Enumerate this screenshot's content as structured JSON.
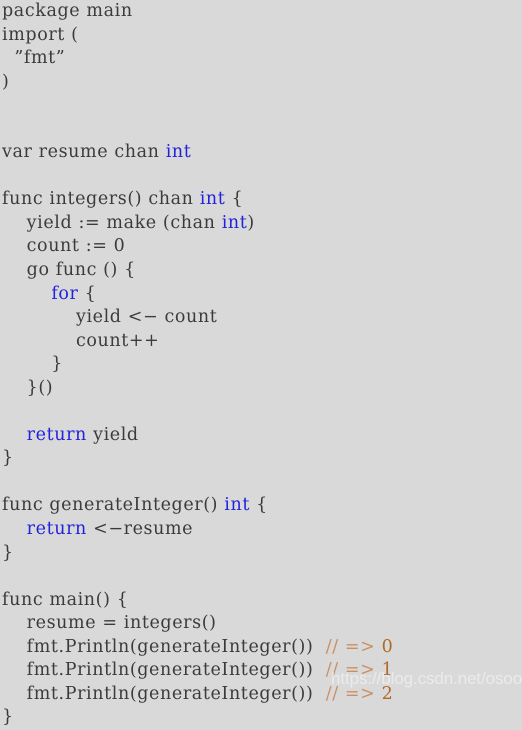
{
  "document": {
    "kind": "code-listing",
    "language": "Go",
    "background_color": "#d9d9d9",
    "default_text_color": "#3b3b3b",
    "keyword_color": "#2222dd",
    "comment_color": "#c98f63",
    "comment_number_color": "#b06a28",
    "watermark_color": "#ededed"
  },
  "watermark": {
    "text": "https://blog.csdn.net/osoon"
  },
  "code": {
    "lines": [
      {
        "indent": 0,
        "tokens": [
          {
            "t": "package main",
            "c": "plain"
          }
        ]
      },
      {
        "indent": 0,
        "tokens": [
          {
            "t": "import (",
            "c": "plain"
          }
        ]
      },
      {
        "indent": 0,
        "tokens": [
          {
            "t": "  ”fmt”",
            "c": "str"
          }
        ]
      },
      {
        "indent": 0,
        "tokens": [
          {
            "t": ")",
            "c": "plain"
          }
        ]
      },
      {
        "indent": 0,
        "tokens": []
      },
      {
        "indent": 0,
        "tokens": []
      },
      {
        "indent": 0,
        "tokens": [
          {
            "t": "var resume chan ",
            "c": "plain"
          },
          {
            "t": "int",
            "c": "kw"
          }
        ]
      },
      {
        "indent": 0,
        "tokens": []
      },
      {
        "indent": 0,
        "tokens": [
          {
            "t": "func integers() chan ",
            "c": "plain"
          },
          {
            "t": "int",
            "c": "kw"
          },
          {
            "t": " {",
            "c": "plain"
          }
        ]
      },
      {
        "indent": 0,
        "tokens": [
          {
            "t": "    yield := make (chan ",
            "c": "plain"
          },
          {
            "t": "int",
            "c": "kw"
          },
          {
            "t": ")",
            "c": "plain"
          }
        ]
      },
      {
        "indent": 0,
        "tokens": [
          {
            "t": "    count := 0",
            "c": "plain"
          }
        ]
      },
      {
        "indent": 0,
        "tokens": [
          {
            "t": "    go func () {",
            "c": "plain"
          }
        ]
      },
      {
        "indent": 0,
        "tokens": [
          {
            "t": "        ",
            "c": "plain"
          },
          {
            "t": "for",
            "c": "kw"
          },
          {
            "t": " {",
            "c": "plain"
          }
        ]
      },
      {
        "indent": 0,
        "tokens": [
          {
            "t": "            yield <− count",
            "c": "plain"
          }
        ]
      },
      {
        "indent": 0,
        "tokens": [
          {
            "t": "            count++",
            "c": "plain"
          }
        ]
      },
      {
        "indent": 0,
        "tokens": [
          {
            "t": "        }",
            "c": "plain"
          }
        ]
      },
      {
        "indent": 0,
        "tokens": [
          {
            "t": "    }()",
            "c": "plain"
          }
        ]
      },
      {
        "indent": 0,
        "tokens": []
      },
      {
        "indent": 0,
        "tokens": [
          {
            "t": "    ",
            "c": "plain"
          },
          {
            "t": "return",
            "c": "kw"
          },
          {
            "t": " yield",
            "c": "plain"
          }
        ]
      },
      {
        "indent": 0,
        "tokens": [
          {
            "t": "}",
            "c": "plain"
          }
        ]
      },
      {
        "indent": 0,
        "tokens": []
      },
      {
        "indent": 0,
        "tokens": [
          {
            "t": "func generateInteger() ",
            "c": "plain"
          },
          {
            "t": "int",
            "c": "kw"
          },
          {
            "t": " {",
            "c": "plain"
          }
        ]
      },
      {
        "indent": 0,
        "tokens": [
          {
            "t": "    ",
            "c": "plain"
          },
          {
            "t": "return",
            "c": "kw"
          },
          {
            "t": " <−resume",
            "c": "plain"
          }
        ]
      },
      {
        "indent": 0,
        "tokens": [
          {
            "t": "}",
            "c": "plain"
          }
        ]
      },
      {
        "indent": 0,
        "tokens": []
      },
      {
        "indent": 0,
        "tokens": [
          {
            "t": "func main() {",
            "c": "plain"
          }
        ]
      },
      {
        "indent": 0,
        "tokens": [
          {
            "t": "    resume = integers()",
            "c": "plain"
          }
        ]
      },
      {
        "indent": 0,
        "tokens": [
          {
            "t": "    fmt.Println(generateInteger())  ",
            "c": "plain"
          },
          {
            "t": "// => ",
            "c": "cmt"
          },
          {
            "t": "0",
            "c": "cmtnum"
          }
        ]
      },
      {
        "indent": 0,
        "tokens": [
          {
            "t": "    fmt.Println(generateInteger())  ",
            "c": "plain"
          },
          {
            "t": "// => ",
            "c": "cmt"
          },
          {
            "t": "1",
            "c": "cmtnum"
          }
        ]
      },
      {
        "indent": 0,
        "tokens": [
          {
            "t": "    fmt.Println(generateInteger())  ",
            "c": "plain"
          },
          {
            "t": "// => ",
            "c": "cmt"
          },
          {
            "t": "2",
            "c": "cmtnum"
          }
        ]
      },
      {
        "indent": 0,
        "tokens": [
          {
            "t": "}",
            "c": "plain"
          }
        ]
      }
    ]
  }
}
